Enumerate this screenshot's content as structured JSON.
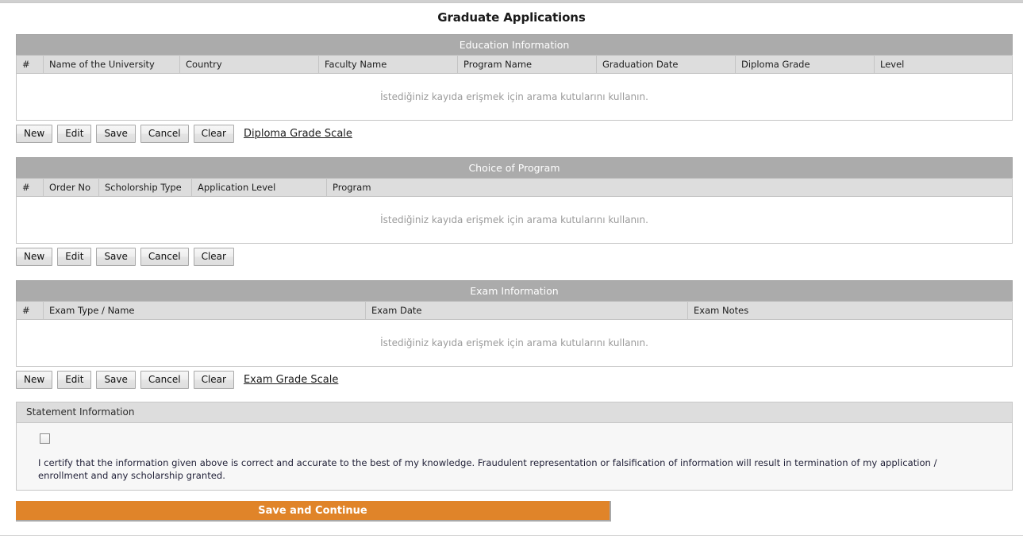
{
  "page": {
    "title": "Graduate Applications",
    "empty_row_message": "İstediğiniz kayıda erişmek için arama kutularını kullanın."
  },
  "colors": {
    "panel_header_bg": "#ababab",
    "column_header_bg": "#dddddd",
    "submit_orange": "#e08429",
    "link_text": "#1c1c1c"
  },
  "sections": {
    "education": {
      "title": "Education Information",
      "columns": [
        "#",
        "Name of the University",
        "Country",
        "Faculty Name",
        "Program Name",
        "Graduation Date",
        "Diploma Grade",
        "Level"
      ],
      "rows": [],
      "empty_message": "İstediğiniz kayıda erişmek için arama kutularını kullanın.",
      "buttons": [
        "New",
        "Edit",
        "Save",
        "Cancel",
        "Clear"
      ],
      "link": "Diploma Grade Scale"
    },
    "program": {
      "title": "Choice of Program",
      "columns": [
        "#",
        "Order No",
        "Scholorship Type",
        "Application Level",
        "Program"
      ],
      "rows": [],
      "empty_message": "İstediğiniz kayıda erişmek için arama kutularını kullanın.",
      "buttons": [
        "New",
        "Edit",
        "Save",
        "Cancel",
        "Clear"
      ],
      "link": ""
    },
    "exam": {
      "title": "Exam Information",
      "columns": [
        "#",
        "Exam Type / Name",
        "Exam Date",
        "Exam Notes"
      ],
      "rows": [],
      "empty_message": "İstediğiniz kayıda erişmek için arama kutularını kullanın.",
      "buttons": [
        "New",
        "Edit",
        "Save",
        "Cancel",
        "Clear"
      ],
      "link": "Exam Grade Scale"
    },
    "statement": {
      "legend": "Statement Information",
      "checkbox_checked": false,
      "certification_text": "I certify that the information given above is correct and accurate to the best of my knowledge. Fraudulent representation or falsification of information will result in termination of my application / enrollment and any scholarship granted."
    }
  },
  "submit": {
    "label": "Save and Continue"
  }
}
